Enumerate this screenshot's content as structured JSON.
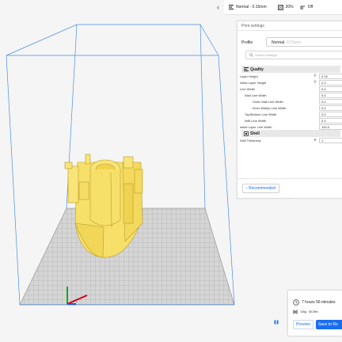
{
  "topbar": {
    "profile_label": "Normal - 0.15mm",
    "infill_label": "20%",
    "support_label": "Off",
    "icons": [
      "chevron-left-icon",
      "layer-profile-icon",
      "infill-icon",
      "support-icon"
    ]
  },
  "panel": {
    "title": "Print settings",
    "profile_label": "Profile",
    "profile_value": "Normal",
    "profile_sub": "0.15mm",
    "search_placeholder": "Search settings",
    "categories": [
      {
        "name": "Quality",
        "icon": "quality-icon"
      },
      {
        "name": "Shell",
        "icon": "shell-icon"
      }
    ],
    "quality_settings": [
      {
        "label": "Layer Height",
        "value": "0.15",
        "icon": "link-icon"
      },
      {
        "label": "Initial Layer Height",
        "value": "0.3",
        "icon": "link-icon"
      },
      {
        "label": "Line Width",
        "value": "0.4"
      },
      {
        "label": "Wall Line Width",
        "value": "0.4"
      },
      {
        "label": "Outer Wall Line Width",
        "value": "0.4"
      },
      {
        "label": "Inner Wall(s) Line Width",
        "value": "0.4"
      },
      {
        "label": "Top/Bottom Line Width",
        "value": "0.4"
      },
      {
        "label": "Infill Line Width",
        "value": "0.4"
      },
      {
        "label": "Initial Layer Line Width",
        "value": "100.0"
      }
    ],
    "shell_settings": [
      {
        "label": "Wall Thickness",
        "value": "1",
        "icon": "info-icon"
      }
    ],
    "recommended_label": "Recommended"
  },
  "estimate": {
    "time": "7 hours 56 minutes",
    "material": "100g · 36.39m",
    "preview_label": "Preview",
    "save_label": "Save to Re"
  },
  "colors": {
    "accent": "#196ef0",
    "model": "#f7e06a",
    "build_volume": "#4a90e2"
  }
}
